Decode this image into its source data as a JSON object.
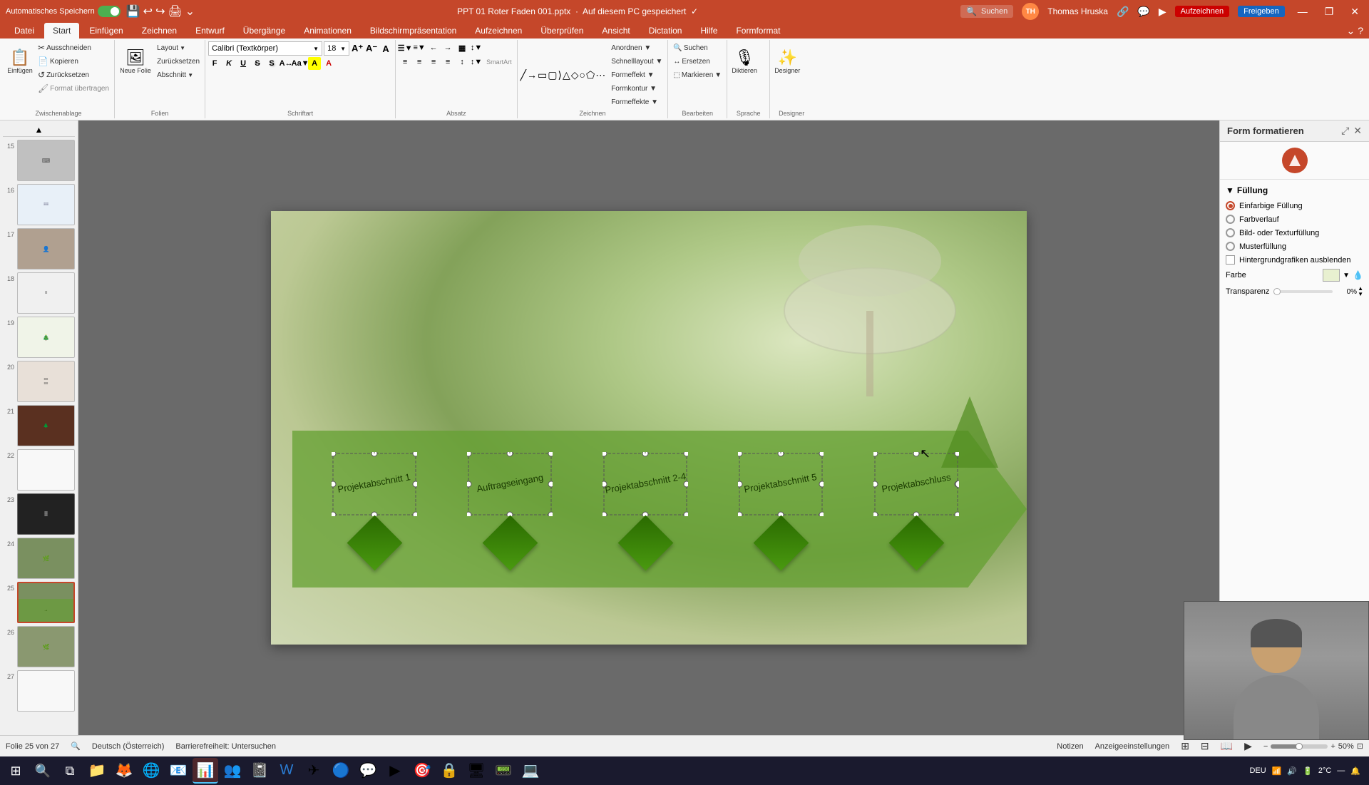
{
  "titlebar": {
    "autosave_label": "Automatisches Speichern",
    "filename": "PPT 01 Roter Faden 001.pptx",
    "saved_status": "Auf diesem PC gespeichert",
    "user_name": "Thomas Hruska",
    "search_placeholder": "Suchen",
    "minimize_icon": "—",
    "restore_icon": "❐",
    "close_icon": "✕"
  },
  "menu": {
    "items": [
      "Datei",
      "Start",
      "Einfügen",
      "Zeichnen",
      "Entwurf",
      "Übergänge",
      "Animationen",
      "Bildschirmpräsentation",
      "Aufzeichnen",
      "Überprüfen",
      "Ansicht",
      "Dictation",
      "Hilfe",
      "Formformat"
    ]
  },
  "ribbon": {
    "active_tab": "Start",
    "groups": {
      "clipboard": {
        "label": "Zwischenablage",
        "einfuegen": "Einfügen",
        "ausschneiden": "Ausschneiden",
        "kopieren": "Kopieren",
        "zuruecksetzen": "Zurücksetzen",
        "format_uebertragen": "Format übertragen"
      },
      "folien": {
        "label": "Folien",
        "neue_folie": "Neue Folie",
        "layout": "Layout",
        "zuruecksetzen_btn": "Zurücksetzen",
        "abschnitt": "Abschnitt"
      },
      "schriftart": {
        "label": "Schriftart",
        "font_name": "Calibri (Textkörper)",
        "font_size": "18",
        "grow": "A",
        "shrink": "A",
        "clear": "A",
        "bold": "F",
        "italic": "K",
        "underline": "U",
        "strikethrough": "S",
        "shadow": "S",
        "char_spacing": "A",
        "case": "Aa",
        "highlight": "A",
        "color": "A"
      },
      "absatz": {
        "label": "Absatz",
        "bullets": "≡",
        "numbering": "≡",
        "dec_indent": "←",
        "inc_indent": "→",
        "cols": "≡",
        "line_spacing": "≡",
        "align_left": "≡",
        "align_center": "≡",
        "align_right": "≡",
        "justify": "≡",
        "text_direction": "↕",
        "align_text": "↕",
        "smartart": "SmartArt"
      },
      "zeichnen": {
        "label": "Zeichnen"
      },
      "bearbeiten": {
        "label": "Bearbeiten",
        "suchen": "Suchen",
        "ersetzen": "Ersetzen",
        "markieren": "Markieren"
      },
      "sprache": {
        "label": "Sprache",
        "diktieren": "Diktieren"
      },
      "designer": {
        "label": "Designer",
        "designer": "Designer"
      }
    }
  },
  "slide_panel": {
    "slides": [
      {
        "num": 15,
        "type": "keyboard"
      },
      {
        "num": 16,
        "type": "text_blue"
      },
      {
        "num": 17,
        "type": "photo"
      },
      {
        "num": 18,
        "type": "text"
      },
      {
        "num": 19,
        "type": "tree"
      },
      {
        "num": 20,
        "type": "text_small"
      },
      {
        "num": 21,
        "type": "red_forest"
      },
      {
        "num": 22,
        "type": "blank"
      },
      {
        "num": 23,
        "type": "dark"
      },
      {
        "num": 24,
        "type": "nature"
      },
      {
        "num": 25,
        "type": "green_active"
      },
      {
        "num": 26,
        "type": "nature2"
      },
      {
        "num": 27,
        "type": "blank2"
      }
    ]
  },
  "slide": {
    "process_items": [
      {
        "label": "Projektabschnitt 1"
      },
      {
        "label": "Auftragseingang"
      },
      {
        "label": "Projektabschnitt 2-4"
      },
      {
        "label": "Projektabschnitt 5"
      },
      {
        "label": "Projektabschluss"
      }
    ]
  },
  "right_panel": {
    "title": "Form formatieren",
    "sections": {
      "fuellung": {
        "label": "Füllung",
        "options": [
          {
            "label": "Einfarbige Füllung",
            "selected": true
          },
          {
            "label": "Farbverlauf",
            "selected": false
          },
          {
            "label": "Bild- oder Texturfüllung",
            "selected": false
          },
          {
            "label": "Musterfüllung",
            "selected": false
          }
        ],
        "checkbox": "Hintergrundgrafiken ausblenden",
        "farbe_label": "Farbe",
        "transparenz_label": "Transparenz",
        "transparenz_value": "0%"
      }
    }
  },
  "status_bar": {
    "slide_info": "Folie 25 von 27",
    "language": "Deutsch (Österreich)",
    "accessibility": "Barrierefreiheit: Untersuchen",
    "notes": "Notizen",
    "view_settings": "Anzeigeeinstellungen",
    "zoom": "—"
  },
  "taskbar": {
    "apps": [
      "⊞",
      "🔍",
      "📁",
      "🦊",
      "🌐",
      "📧",
      "📊",
      "🖥",
      "👤",
      "🎨",
      "📱",
      "🔔",
      "📝",
      "🔵",
      "💬",
      "▶",
      "🎯",
      "🔒",
      "📟",
      "💻"
    ],
    "system": {
      "weather": "2°C",
      "time": "—"
    }
  },
  "video_overlay": {
    "visible": true
  },
  "colors": {
    "accent": "#c5472a",
    "green_arrow": "rgba(100,160,50,0.75)",
    "diamond": "#3a7a05"
  }
}
